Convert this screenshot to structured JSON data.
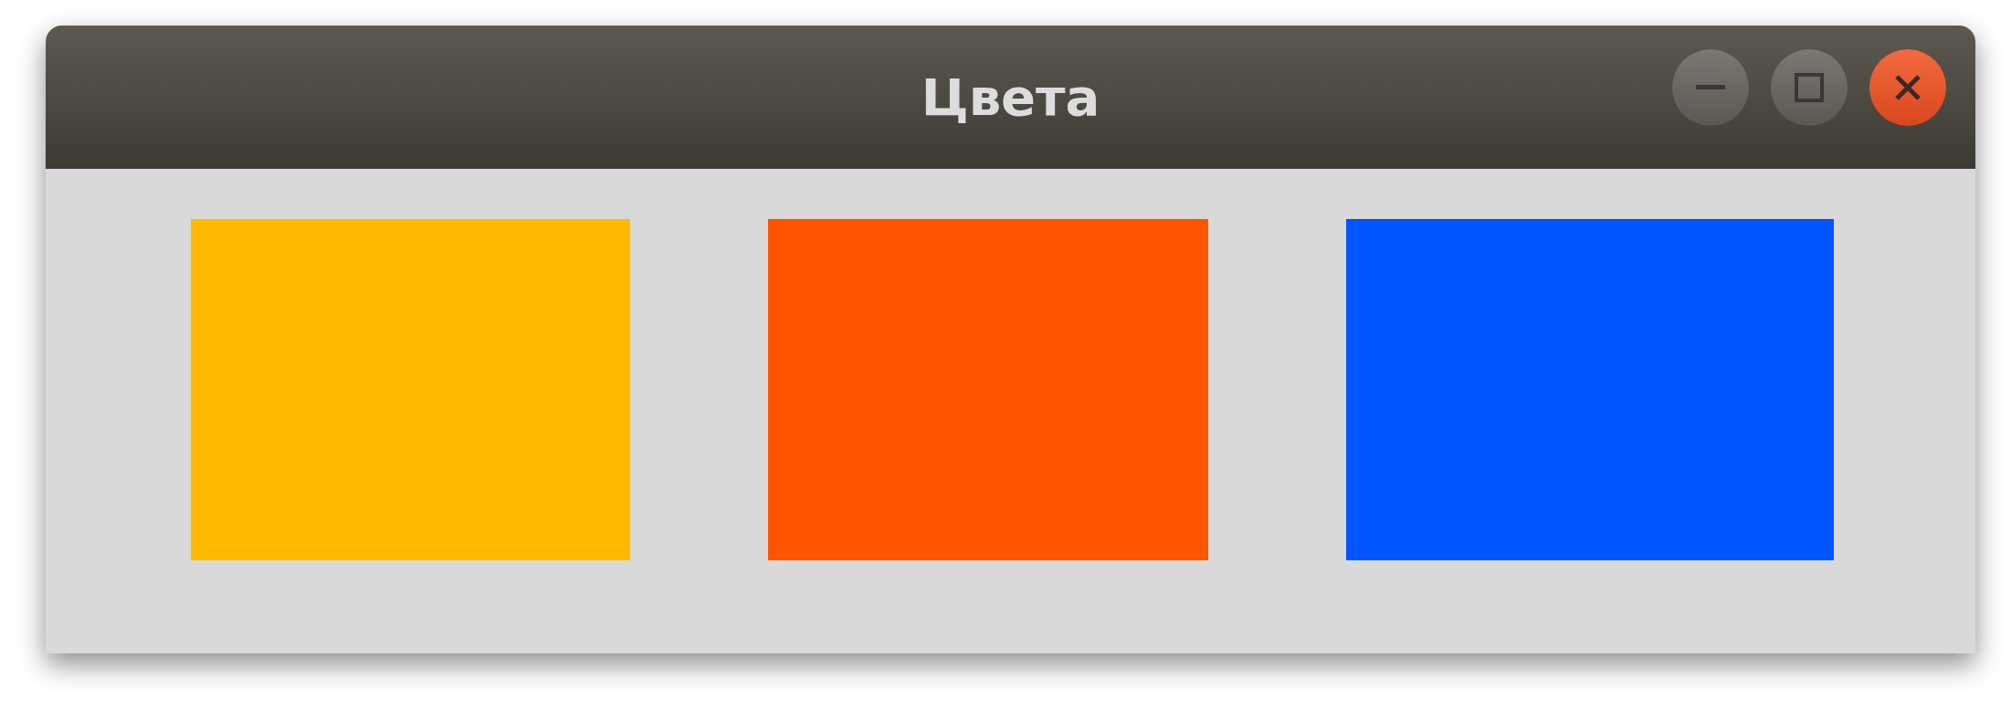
{
  "window": {
    "title": "Цвета"
  },
  "swatches": [
    {
      "color": "#ffba00"
    },
    {
      "color": "#ff5500"
    },
    {
      "color": "#0055ff"
    }
  ]
}
